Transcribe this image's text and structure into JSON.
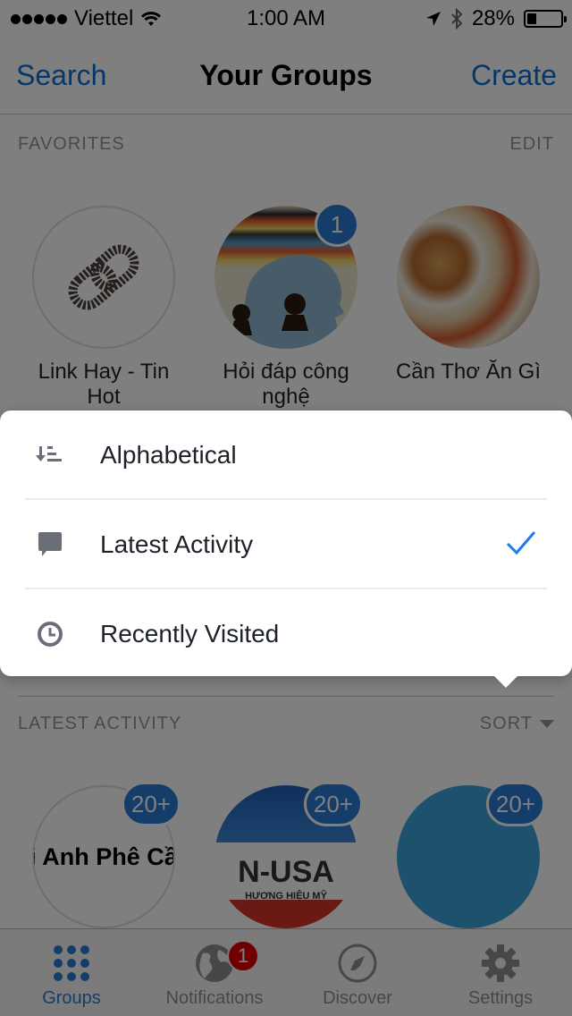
{
  "status_bar": {
    "carrier": "Viettel",
    "time": "1:00 AM",
    "battery_percent_label": "28%",
    "battery_level": 0.28,
    "icons": [
      "signal-dots-icon",
      "wifi-icon",
      "location-arrow-icon",
      "bluetooth-icon",
      "battery-icon"
    ]
  },
  "nav": {
    "left_button": "Search",
    "title": "Your Groups",
    "right_button": "Create"
  },
  "favorites": {
    "header": "FAVORITES",
    "action": "EDIT",
    "groups": [
      {
        "name": "Link Hay - Tin Hot",
        "badge": ""
      },
      {
        "name": "Hỏi đáp công nghệ",
        "badge": "1"
      },
      {
        "name": "Cần Thơ Ăn Gì",
        "badge": ""
      }
    ]
  },
  "latest_activity": {
    "header": "LATEST ACTIVITY",
    "action": "SORT",
    "groups": [
      {
        "image_text": "i Anh Phê Cầ",
        "badge": "20+"
      },
      {
        "image_text": "N-USA",
        "image_subtext": "HƯƠNG HIỆU MỸ",
        "badge": "20+"
      },
      {
        "image_text": "",
        "badge": "20+"
      }
    ]
  },
  "sort_menu": {
    "options": [
      {
        "label": "Alphabetical",
        "icon": "sort-alpha-icon",
        "selected": false
      },
      {
        "label": "Latest Activity",
        "icon": "chat-bubble-icon",
        "selected": true
      },
      {
        "label": "Recently Visited",
        "icon": "clock-icon",
        "selected": false
      }
    ]
  },
  "tabbar": {
    "tabs": [
      {
        "label": "Groups",
        "icon": "grid-dots-icon",
        "active": true,
        "badge": ""
      },
      {
        "label": "Notifications",
        "icon": "globe-icon",
        "active": false,
        "badge": "1"
      },
      {
        "label": "Discover",
        "icon": "compass-icon",
        "active": false,
        "badge": ""
      },
      {
        "label": "Settings",
        "icon": "gear-icon",
        "active": false,
        "badge": ""
      }
    ]
  },
  "colors": {
    "accent": "#2a7bd4",
    "notification_badge": "#e00000",
    "overlay": "rgba(0,0,0,0.5)"
  }
}
